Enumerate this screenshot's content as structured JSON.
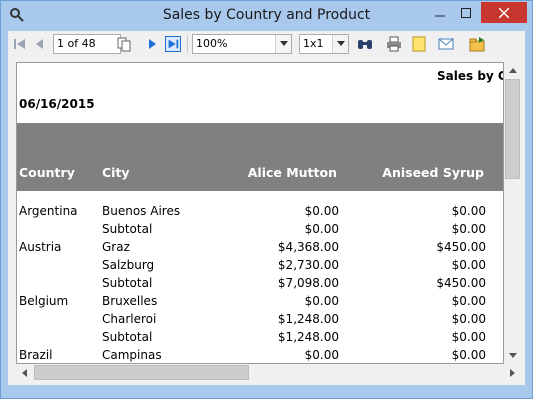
{
  "window": {
    "title": "Sales by Country and Product"
  },
  "toolbar": {
    "page_value": "1 of 48",
    "zoom_value": "100%",
    "layout_value": "1x1"
  },
  "report": {
    "title": "Sales by C",
    "date": "06/16/2015",
    "headers": {
      "country": "Country",
      "city": "City",
      "alice": "Alice Mutton",
      "aniseed": "Aniseed Syrup"
    },
    "rows": [
      {
        "country": "Argentina",
        "city": "Buenos Aires",
        "alice": "$0.00",
        "aniseed": "$0.00"
      },
      {
        "country": "",
        "city": "Subtotal",
        "alice": "$0.00",
        "aniseed": "$0.00"
      },
      {
        "country": "Austria",
        "city": "Graz",
        "alice": "$4,368.00",
        "aniseed": "$450.00"
      },
      {
        "country": "",
        "city": "Salzburg",
        "alice": "$2,730.00",
        "aniseed": "$0.00"
      },
      {
        "country": "",
        "city": "Subtotal",
        "alice": "$7,098.00",
        "aniseed": "$450.00"
      },
      {
        "country": "Belgium",
        "city": "Bruxelles",
        "alice": "$0.00",
        "aniseed": "$0.00"
      },
      {
        "country": "",
        "city": "Charleroi",
        "alice": "$1,248.00",
        "aniseed": "$0.00"
      },
      {
        "country": "",
        "city": "Subtotal",
        "alice": "$1,248.00",
        "aniseed": "$0.00"
      },
      {
        "country": "Brazil",
        "city": "Campinas",
        "alice": "$0.00",
        "aniseed": "$0.00"
      }
    ]
  },
  "icons": [
    "app-icon",
    "minimize-icon",
    "maximize-icon",
    "close-icon",
    "first-page-icon",
    "previous-page-icon",
    "copy-icon",
    "next-page-icon",
    "last-page-icon",
    "find-icon",
    "print-icon",
    "page-setup-icon",
    "email-icon",
    "export-icon",
    "scroll-up-icon",
    "scroll-down-icon",
    "scroll-left-icon",
    "scroll-right-icon"
  ],
  "colors": {
    "titlebar": "#a8c8ec",
    "close": "#c7372f",
    "header_band": "#808080"
  }
}
